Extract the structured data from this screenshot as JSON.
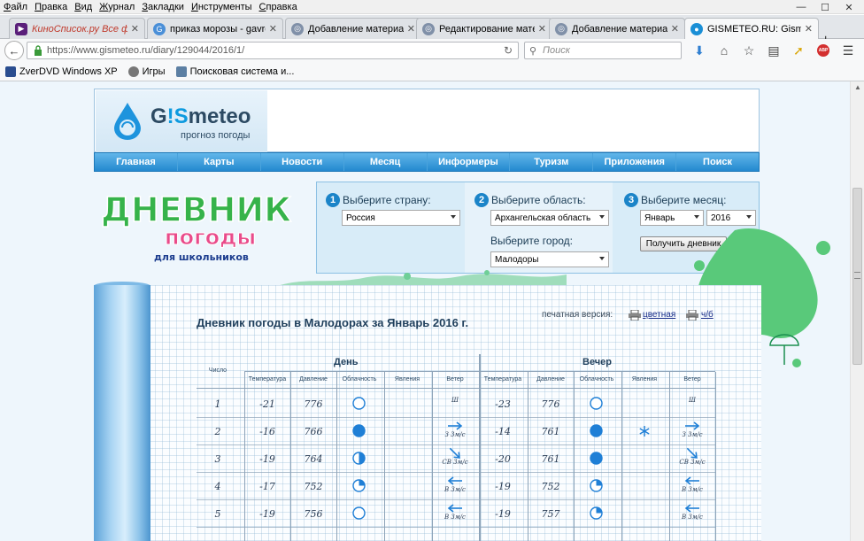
{
  "browser": {
    "menu": [
      "Файл",
      "Правка",
      "Вид",
      "Журнал",
      "Закладки",
      "Инструменты",
      "Справка"
    ],
    "tabs": [
      {
        "title": "КиноСписок.ру Все фил...",
        "icon": "kinospisok-icon",
        "color": "#6b2a8c"
      },
      {
        "title": "приказ морозы - gavros...",
        "icon": "google-icon",
        "color": "#4a8fd8"
      },
      {
        "title": "Добавление материала ...",
        "icon": "joomla-icon",
        "color": "#8090a8"
      },
      {
        "title": "Редактирование матери...",
        "icon": "joomla-icon",
        "color": "#8090a8"
      },
      {
        "title": "Добавление материала ...",
        "icon": "joomla-icon",
        "color": "#8090a8"
      },
      {
        "title": "GISMETEO.RU: Gismeteo...",
        "icon": "gismeteo-icon",
        "color": "#1a8fd6"
      }
    ],
    "url": "https://www.gismeteo.ru/diary/129044/2016/1/",
    "search_placeholder": "Поиск",
    "bookmarks": [
      "ZverDVD Windows XP",
      "Игры",
      "Поисковая система и..."
    ]
  },
  "site": {
    "logo_word_a": "G",
    "logo_word_b": "!S",
    "logo_word_c": "meteo",
    "logo_sub": "прогноз погоды",
    "nav": [
      "Главная",
      "Карты",
      "Новости",
      "Месяц",
      "Информеры",
      "Туризм",
      "Приложения",
      "Поиск"
    ],
    "diary_logo": {
      "line1": "ДНЕВНИК",
      "line2": "погоды",
      "line3": "для школьников"
    }
  },
  "selectors": {
    "country": {
      "num": "1",
      "label": "Выберите страну:",
      "value": "Россия"
    },
    "region": {
      "num": "2",
      "label": "Выберите область:",
      "value": "Архангельская область"
    },
    "city": {
      "label": "Выберите город:",
      "value": "Малодоры"
    },
    "month": {
      "num": "3",
      "label": "Выберите месяц:",
      "value": "Январь",
      "year": "2016"
    },
    "button": "Получить дневник"
  },
  "diary": {
    "title": "Дневник погоды в Малодорах за Январь 2016 г.",
    "print_label": "печатная версия:",
    "print_color": "цветная",
    "print_bw": "ч/б",
    "col_date": "Число",
    "day_header": "День",
    "evening_header": "Вечер",
    "columns": [
      "Температура",
      "Давление",
      "Облачность",
      "Явления",
      "Ветер"
    ],
    "rows": [
      {
        "date": "1",
        "day": {
          "temp": "-21",
          "press": "776",
          "cloud": "clear",
          "phen": "",
          "wind_dir": "",
          "wind": "Ш"
        },
        "eve": {
          "temp": "-23",
          "press": "776",
          "cloud": "clear",
          "phen": "",
          "wind_dir": "",
          "wind": "Ш"
        }
      },
      {
        "date": "2",
        "day": {
          "temp": "-16",
          "press": "766",
          "cloud": "overcast",
          "phen": "",
          "wind_dir": "E",
          "wind": "З 3м/с"
        },
        "eve": {
          "temp": "-14",
          "press": "761",
          "cloud": "overcast",
          "phen": "snow",
          "wind_dir": "E",
          "wind": "З 3м/с"
        }
      },
      {
        "date": "3",
        "day": {
          "temp": "-19",
          "press": "764",
          "cloud": "half",
          "phen": "",
          "wind_dir": "SE",
          "wind": "СВ 3м/с"
        },
        "eve": {
          "temp": "-20",
          "press": "761",
          "cloud": "overcast",
          "phen": "",
          "wind_dir": "SE",
          "wind": "СВ 3м/с"
        }
      },
      {
        "date": "4",
        "day": {
          "temp": "-17",
          "press": "752",
          "cloud": "partly",
          "phen": "",
          "wind_dir": "W",
          "wind": "В 3м/с"
        },
        "eve": {
          "temp": "-19",
          "press": "752",
          "cloud": "partly",
          "phen": "",
          "wind_dir": "W",
          "wind": "В 3м/с"
        }
      },
      {
        "date": "5",
        "day": {
          "temp": "-19",
          "press": "756",
          "cloud": "clear",
          "phen": "",
          "wind_dir": "W",
          "wind": "В 3м/с"
        },
        "eve": {
          "temp": "-19",
          "press": "757",
          "cloud": "partly",
          "phen": "",
          "wind_dir": "W",
          "wind": "В 3м/с"
        }
      }
    ]
  },
  "colors": {
    "nav_blue": "#2389cf",
    "accent": "#1b84c8",
    "link": "#1a2e8a"
  }
}
